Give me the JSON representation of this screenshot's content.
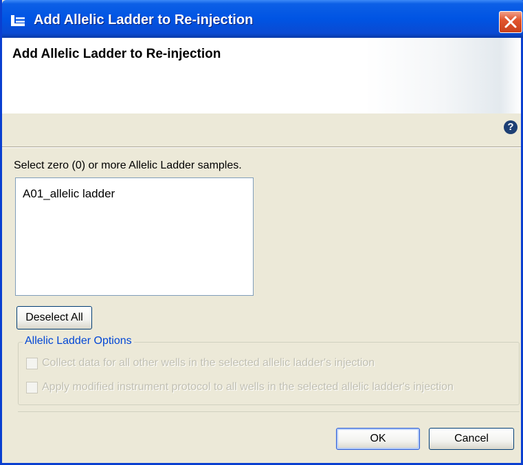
{
  "window": {
    "title": "Add Allelic Ladder to Re-injection",
    "close_icon": "close-icon",
    "app_icon": "app-icon"
  },
  "banner": {
    "title": "Add Allelic Ladder to Re-injection",
    "help_icon": "help-icon"
  },
  "samples": {
    "prompt": "Select zero (0) or more Allelic Ladder samples.",
    "items": [
      "A01_allelic ladder"
    ],
    "deselect_all_label": "Deselect All"
  },
  "options": {
    "group_label": "Allelic Ladder Options",
    "items": [
      {
        "label": "Collect data for all other wells in the selected allelic ladder's injection",
        "checked": false,
        "enabled": false
      },
      {
        "label": "Apply modified instrument protocol to all wells in the selected allelic ladder's injection",
        "checked": false,
        "enabled": false
      }
    ]
  },
  "footer": {
    "ok_label": "OK",
    "cancel_label": "Cancel"
  },
  "colors": {
    "titlebar": "#0054e3",
    "dialog_background": "#ece9d8",
    "group_label": "#0046d5",
    "close_button": "#e2552e"
  }
}
